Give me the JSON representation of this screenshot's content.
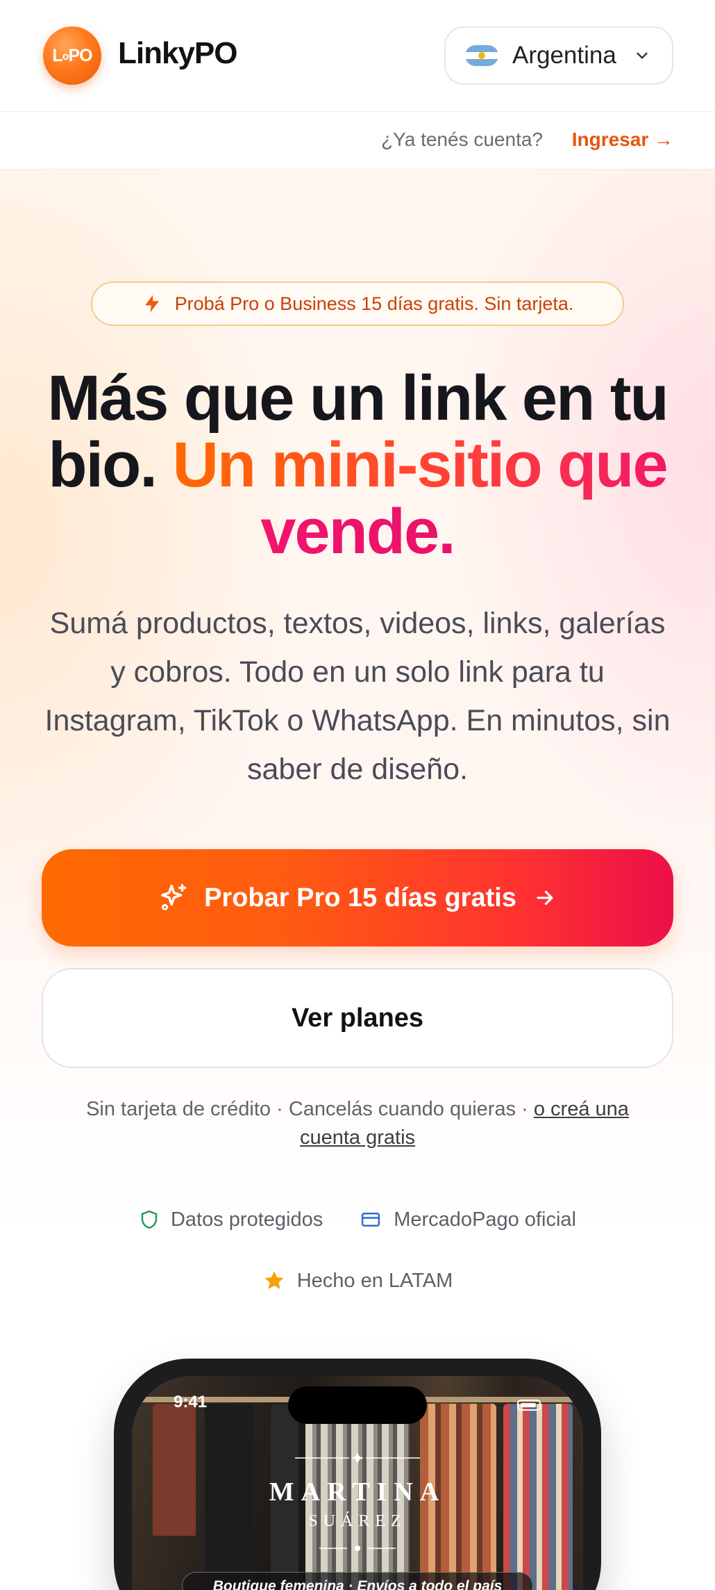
{
  "header": {
    "logo_text": "LoPO",
    "brand": "LinkyPO",
    "country": {
      "label": "Argentina",
      "flag": "argentina-flag"
    }
  },
  "subbar": {
    "question": "¿Ya tenés cuenta?",
    "login": "Ingresar →"
  },
  "hero": {
    "badge": "Probá Pro o Business 15 días gratis. Sin tarjeta.",
    "headline_plain": "Más que un link en tu bio.",
    "headline_accent": "Un mini-sitio que vende.",
    "subtext": "Sumá productos, textos, videos, links, galerías y cobros. Todo en un solo link para tu Instagram, TikTok o WhatsApp. En minutos, sin saber de diseño.",
    "cta_primary": "Probar Pro 15 días gratis",
    "cta_secondary": "Ver planes",
    "fineprint": "Sin tarjeta de crédito · Cancelás cuando quieras ·",
    "fineprint_link": "o creá una cuenta gratis",
    "trust": [
      {
        "label": "Datos protegidos",
        "icon": "shield-icon"
      },
      {
        "label": "MercadoPago oficial",
        "icon": "card-icon"
      },
      {
        "label": "Hecho en LATAM",
        "icon": "star-icon"
      }
    ]
  },
  "phone_preview": {
    "time": "9:41",
    "name_first": "MARTINA",
    "name_last": "SUÁREZ",
    "tagline": "Boutique femenina · Envíos a todo el país"
  },
  "colors": {
    "accent_orange": "#ff6a00",
    "accent_pink": "#ec0f49",
    "link_orange": "#e8560e"
  }
}
